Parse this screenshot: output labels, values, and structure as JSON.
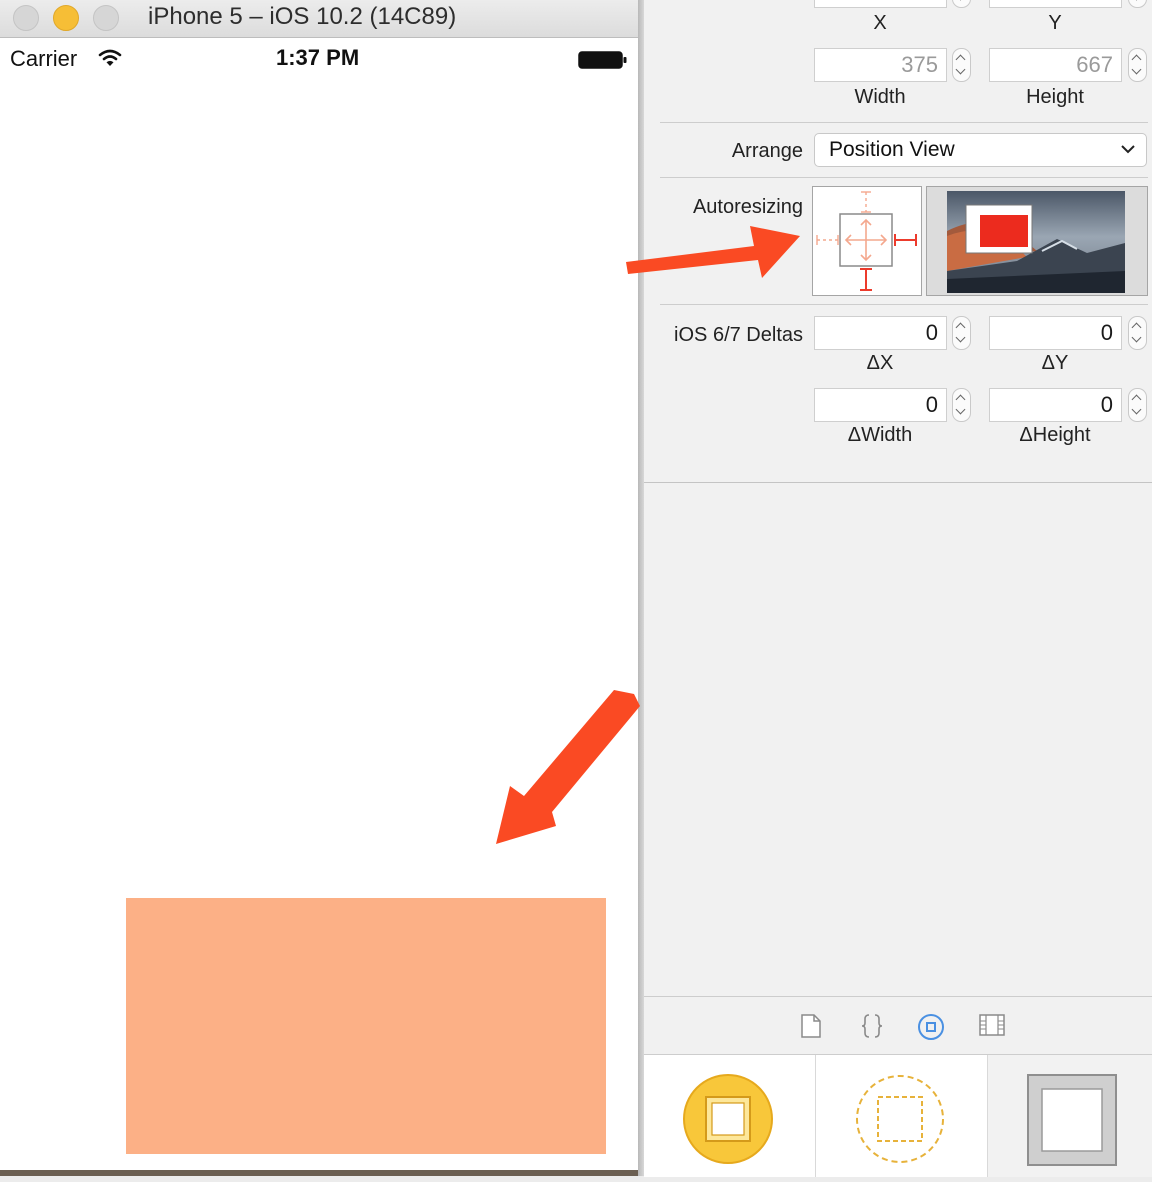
{
  "window": {
    "title": "iPhone 5 – iOS 10.2 (14C89)"
  },
  "status_bar": {
    "carrier": "Carrier",
    "time": "1:37 PM"
  },
  "inspector": {
    "position": {
      "x_label": "X",
      "y_label": "Y"
    },
    "size": {
      "width": "375",
      "height": "667",
      "width_label": "Width",
      "height_label": "Height"
    },
    "arrange": {
      "label": "Arrange",
      "value": "Position View"
    },
    "autoresizing": {
      "label": "Autoresizing"
    },
    "deltas": {
      "label": "iOS 6/7 Deltas",
      "dx": "0",
      "dy": "0",
      "dwidth": "0",
      "dheight": "0",
      "dx_label": "ΔX",
      "dy_label": "ΔY",
      "dwidth_label": "ΔWidth",
      "dheight_label": "ΔHeight"
    }
  },
  "colors": {
    "view_background": "#fcb086",
    "annotation_arrow": "#fa4a23",
    "autoresize_active": "#ec3b2c",
    "autoresize_inactive": "#f29b86"
  },
  "library_tabs": [
    "file-template-icon",
    "code-snippet-icon",
    "object-library-icon",
    "media-library-icon"
  ]
}
